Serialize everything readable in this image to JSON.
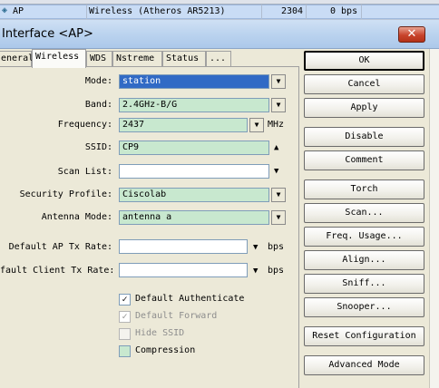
{
  "list_row": {
    "name": "AP",
    "type": "Wireless (Atheros AR5213)",
    "mtu": "2304",
    "rate": "0 bps"
  },
  "window": {
    "title": "Interface <AP>",
    "close_icon": "close-x-icon"
  },
  "tabs": [
    "eneral",
    "Wireless",
    "WDS",
    "Nstreme",
    "Status",
    "..."
  ],
  "form": {
    "mode": {
      "label": "Mode:",
      "value": "station"
    },
    "band": {
      "label": "Band:",
      "value": "2.4GHz-B/G"
    },
    "frequency": {
      "label": "Frequency:",
      "value": "2437",
      "unit": "MHz"
    },
    "ssid": {
      "label": "SSID:",
      "value": "CP9"
    },
    "scan_list": {
      "label": "Scan List:",
      "value": ""
    },
    "security_profile": {
      "label": "Security Profile:",
      "value": "Ciscolab"
    },
    "antenna_mode": {
      "label": "Antenna Mode:",
      "value": "antenna a"
    },
    "default_ap_tx_rate": {
      "label": "Default AP Tx Rate:",
      "value": "",
      "unit": "bps"
    },
    "default_client_tx_rate": {
      "label": "fault Client Tx Rate:",
      "value": "",
      "unit": "bps"
    }
  },
  "checkboxes": [
    {
      "label": "Default Authenticate",
      "checked": true,
      "disabled": false
    },
    {
      "label": "Default Forward",
      "checked": true,
      "disabled": true
    },
    {
      "label": "Hide SSID",
      "checked": false,
      "disabled": true
    },
    {
      "label": "Compression",
      "checked": false,
      "disabled": false
    }
  ],
  "buttons": {
    "ok": "OK",
    "cancel": "Cancel",
    "apply": "Apply",
    "disable": "Disable",
    "comment": "Comment",
    "torch": "Torch",
    "scan": "Scan...",
    "freq_usage": "Freq. Usage...",
    "align": "Align...",
    "sniff": "Sniff...",
    "snooper": "Snooper...",
    "reset_configuration": "Reset Configuration",
    "advanced_mode": "Advanced Mode"
  },
  "colors": {
    "field_green": "#c8e8cf",
    "selection_blue": "#316ac5",
    "close_red": "#c8442c"
  }
}
